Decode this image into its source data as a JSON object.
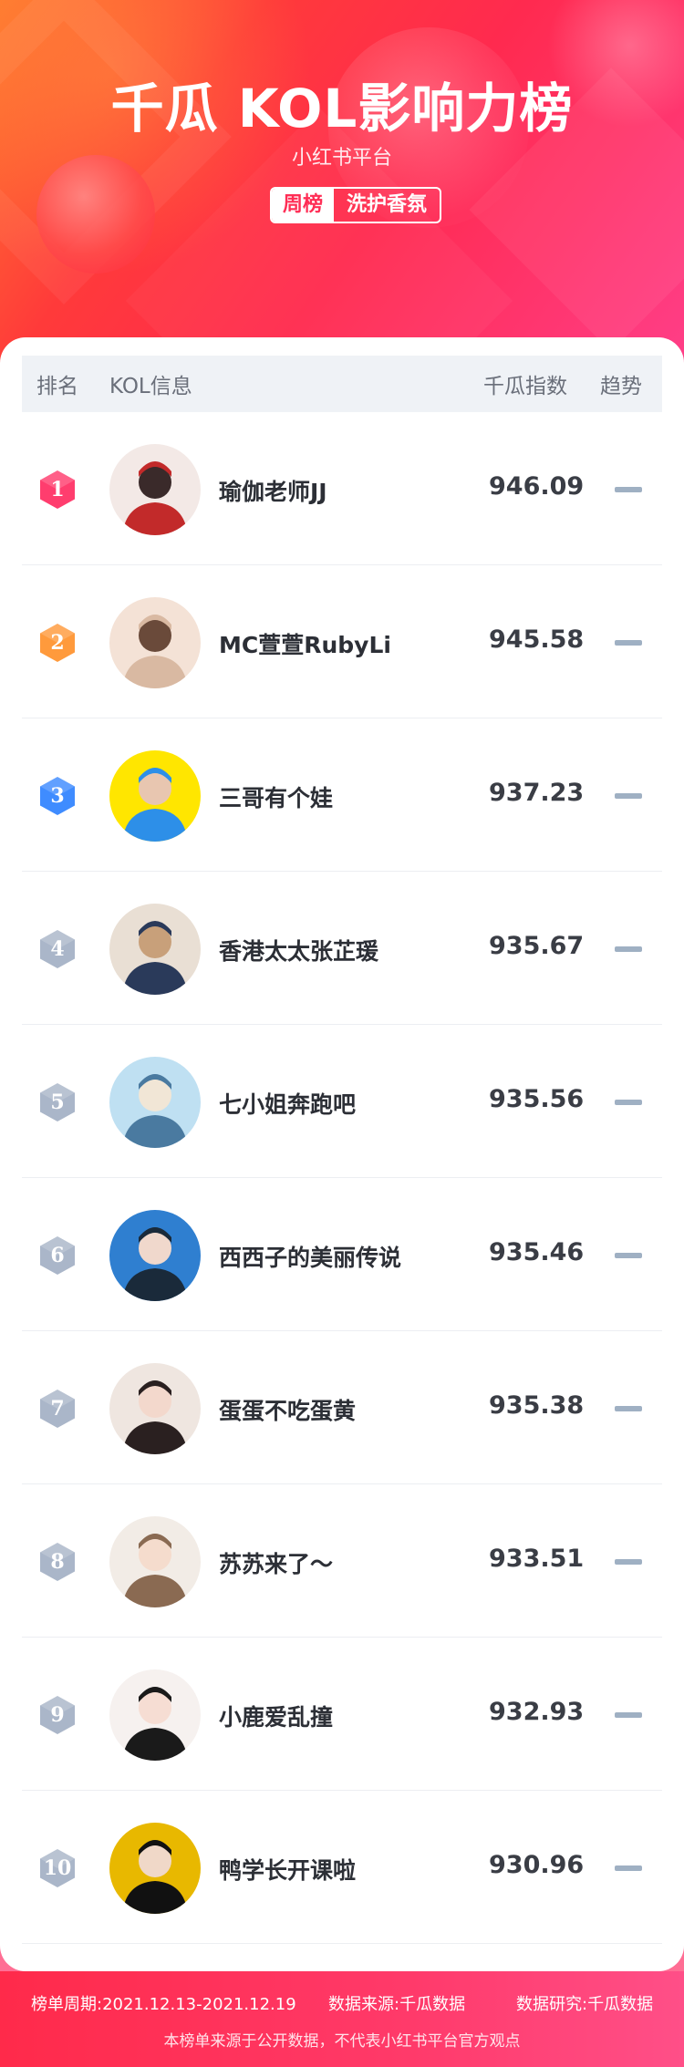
{
  "header": {
    "title": "千瓜 KOL影响力榜",
    "subtitle": "小红书平台",
    "tag_period": "周榜",
    "tag_category": "洗护香氛"
  },
  "table": {
    "col_rank": "排名",
    "col_info": "KOL信息",
    "col_index": "千瓜指数",
    "col_trend": "趋势"
  },
  "rows": [
    {
      "rank": "1",
      "name": "瑜伽老师JJ",
      "score": "946.09",
      "badge_color": "#ff3d6e",
      "avatar": "person-avatar"
    },
    {
      "rank": "2",
      "name": "MC萱萱RubyLi",
      "score": "945.58",
      "badge_color": "#ff9a3c",
      "avatar": "person-avatar"
    },
    {
      "rank": "3",
      "name": "三哥有个娃",
      "score": "937.23",
      "badge_color": "#3f8cff",
      "avatar": "person-avatar"
    },
    {
      "rank": "4",
      "name": "香港太太张芷瑗",
      "score": "935.67",
      "badge_color": "#aab6c9",
      "avatar": "person-avatar"
    },
    {
      "rank": "5",
      "name": "七小姐奔跑吧",
      "score": "935.56",
      "badge_color": "#aab6c9",
      "avatar": "person-avatar"
    },
    {
      "rank": "6",
      "name": "西西子的美丽传说",
      "score": "935.46",
      "badge_color": "#aab6c9",
      "avatar": "person-avatar"
    },
    {
      "rank": "7",
      "name": "蛋蛋不吃蛋黄",
      "score": "935.38",
      "badge_color": "#aab6c9",
      "avatar": "person-avatar"
    },
    {
      "rank": "8",
      "name": "苏苏来了～",
      "score": "933.51",
      "badge_color": "#aab6c9",
      "avatar": "person-avatar"
    },
    {
      "rank": "9",
      "name": "小鹿爱乱撞",
      "score": "932.93",
      "badge_color": "#aab6c9",
      "avatar": "person-avatar"
    },
    {
      "rank": "10",
      "name": "鸭学长开课啦",
      "score": "930.96",
      "badge_color": "#aab6c9",
      "avatar": "person-avatar"
    }
  ],
  "footer": {
    "period": "榜单周期:2021.12.13-2021.12.19",
    "source": "数据来源:千瓜数据",
    "research": "数据研究:千瓜数据",
    "disclaimer": "本榜单来源于公开数据，不代表小红书平台官方观点"
  },
  "colors": {
    "brand": "#ff2d55",
    "trend_flat": "#9fb0c3"
  }
}
